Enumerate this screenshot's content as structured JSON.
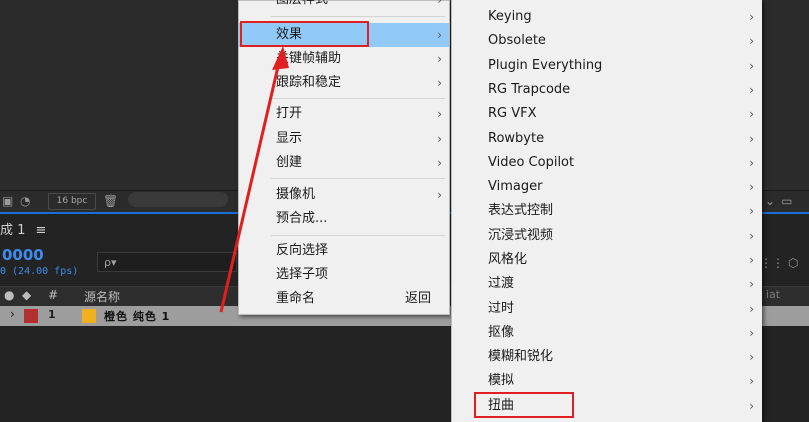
{
  "toolbar": {
    "bpc": "16 bpc"
  },
  "comp_panel": {
    "tab_label": "成 1",
    "menu_glyph": "≡",
    "timecode": "0000",
    "fps": "0 (24.00 fps)",
    "search_glyph": "ρ▾",
    "columns": {
      "hash": "#",
      "source_name": "源名称",
      "right": "iat"
    },
    "layer": {
      "number": "1",
      "name": "橙色 纯色 1"
    }
  },
  "context_menu": {
    "items": [
      {
        "label": "图层样式",
        "arrow": "›"
      },
      {
        "label": "效果",
        "arrow": "›",
        "highlighted": true
      },
      {
        "label": "关键帧辅助",
        "arrow": "›"
      },
      {
        "label": "跟踪和稳定",
        "arrow": "›"
      },
      {
        "label": "打开",
        "arrow": "›"
      },
      {
        "label": "显示",
        "arrow": "›"
      },
      {
        "label": "创建",
        "arrow": "›"
      },
      {
        "label": "摄像机",
        "arrow": "›"
      },
      {
        "label": "预合成..."
      },
      {
        "label": "反向选择"
      },
      {
        "label": "选择子项"
      },
      {
        "label": "重命名",
        "shortcut": "返回"
      }
    ]
  },
  "effects_submenu": {
    "items": [
      {
        "label": "Keying",
        "arrow": "›"
      },
      {
        "label": "Obsolete",
        "arrow": "›"
      },
      {
        "label": "Plugin Everything",
        "arrow": "›"
      },
      {
        "label": "RG Trapcode",
        "arrow": "›"
      },
      {
        "label": "RG VFX",
        "arrow": "›"
      },
      {
        "label": "Rowbyte",
        "arrow": "›"
      },
      {
        "label": "Video Copilot",
        "arrow": "›"
      },
      {
        "label": "Vimager",
        "arrow": "›"
      },
      {
        "label": "表达式控制",
        "arrow": "›"
      },
      {
        "label": "沉浸式视频",
        "arrow": "›"
      },
      {
        "label": "风格化",
        "arrow": "›"
      },
      {
        "label": "过渡",
        "arrow": "›"
      },
      {
        "label": "过时",
        "arrow": "›"
      },
      {
        "label": "抠像",
        "arrow": "›"
      },
      {
        "label": "模糊和锐化",
        "arrow": "›"
      },
      {
        "label": "模拟",
        "arrow": "›"
      },
      {
        "label": "扭曲",
        "arrow": "›"
      }
    ]
  },
  "annotation_color": "#e02020",
  "highlight_color": "#91c9f7"
}
